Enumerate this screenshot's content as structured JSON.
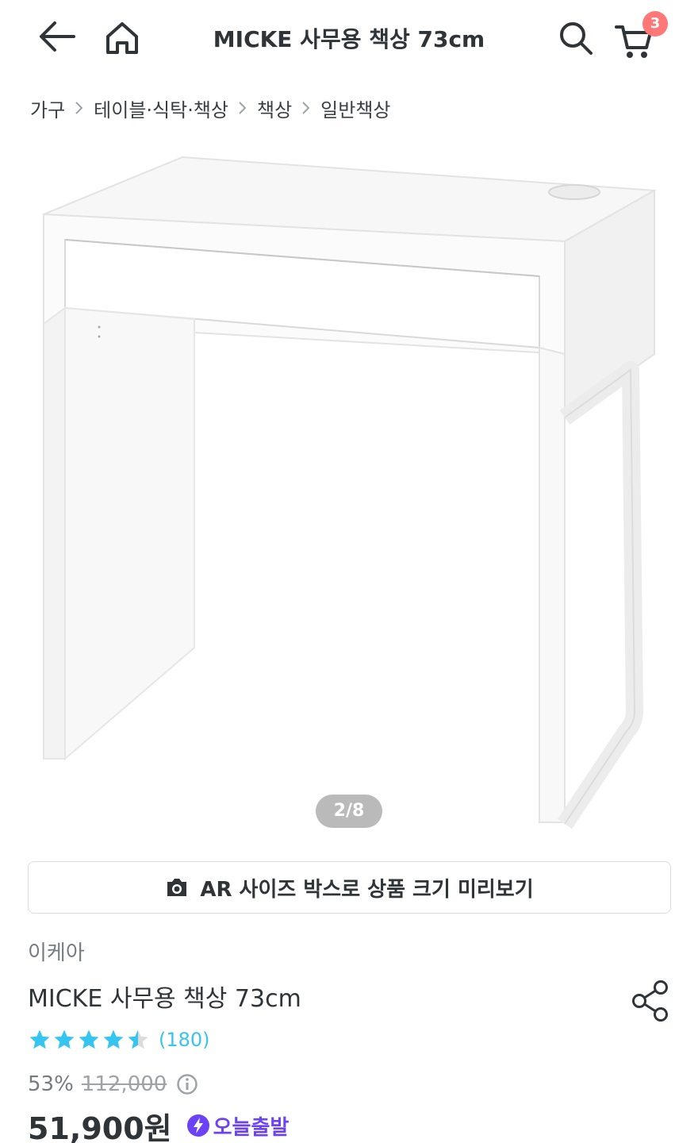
{
  "header": {
    "title": "MICKE 사무용 책상 73cm",
    "cart_count": "3",
    "icons": [
      "back-arrow-icon",
      "home-icon",
      "search-icon",
      "cart-icon"
    ]
  },
  "breadcrumb": [
    "가구",
    "테이블·식탁·책상",
    "책상",
    "일반책상"
  ],
  "gallery": {
    "counter": "2/8",
    "current": 2,
    "total": 8
  },
  "ar_button": {
    "label": "AR 사이즈 박스로 상품 크기 미리보기",
    "icon": "camera-icon"
  },
  "product": {
    "brand": "이케아",
    "name": "MICKE 사무용 책상 73cm",
    "rating": 4.5,
    "review_count": "(180)",
    "discount": "53%",
    "original_price": "112,000",
    "price": "51,900원",
    "delivery_badge": "오늘출발"
  },
  "colors": {
    "text": "#2f3438",
    "secondary": "#757b80",
    "accent_blue": "#35c5f0",
    "badge_purple": "#6b42f5",
    "cart_badge": "#ff7777"
  }
}
